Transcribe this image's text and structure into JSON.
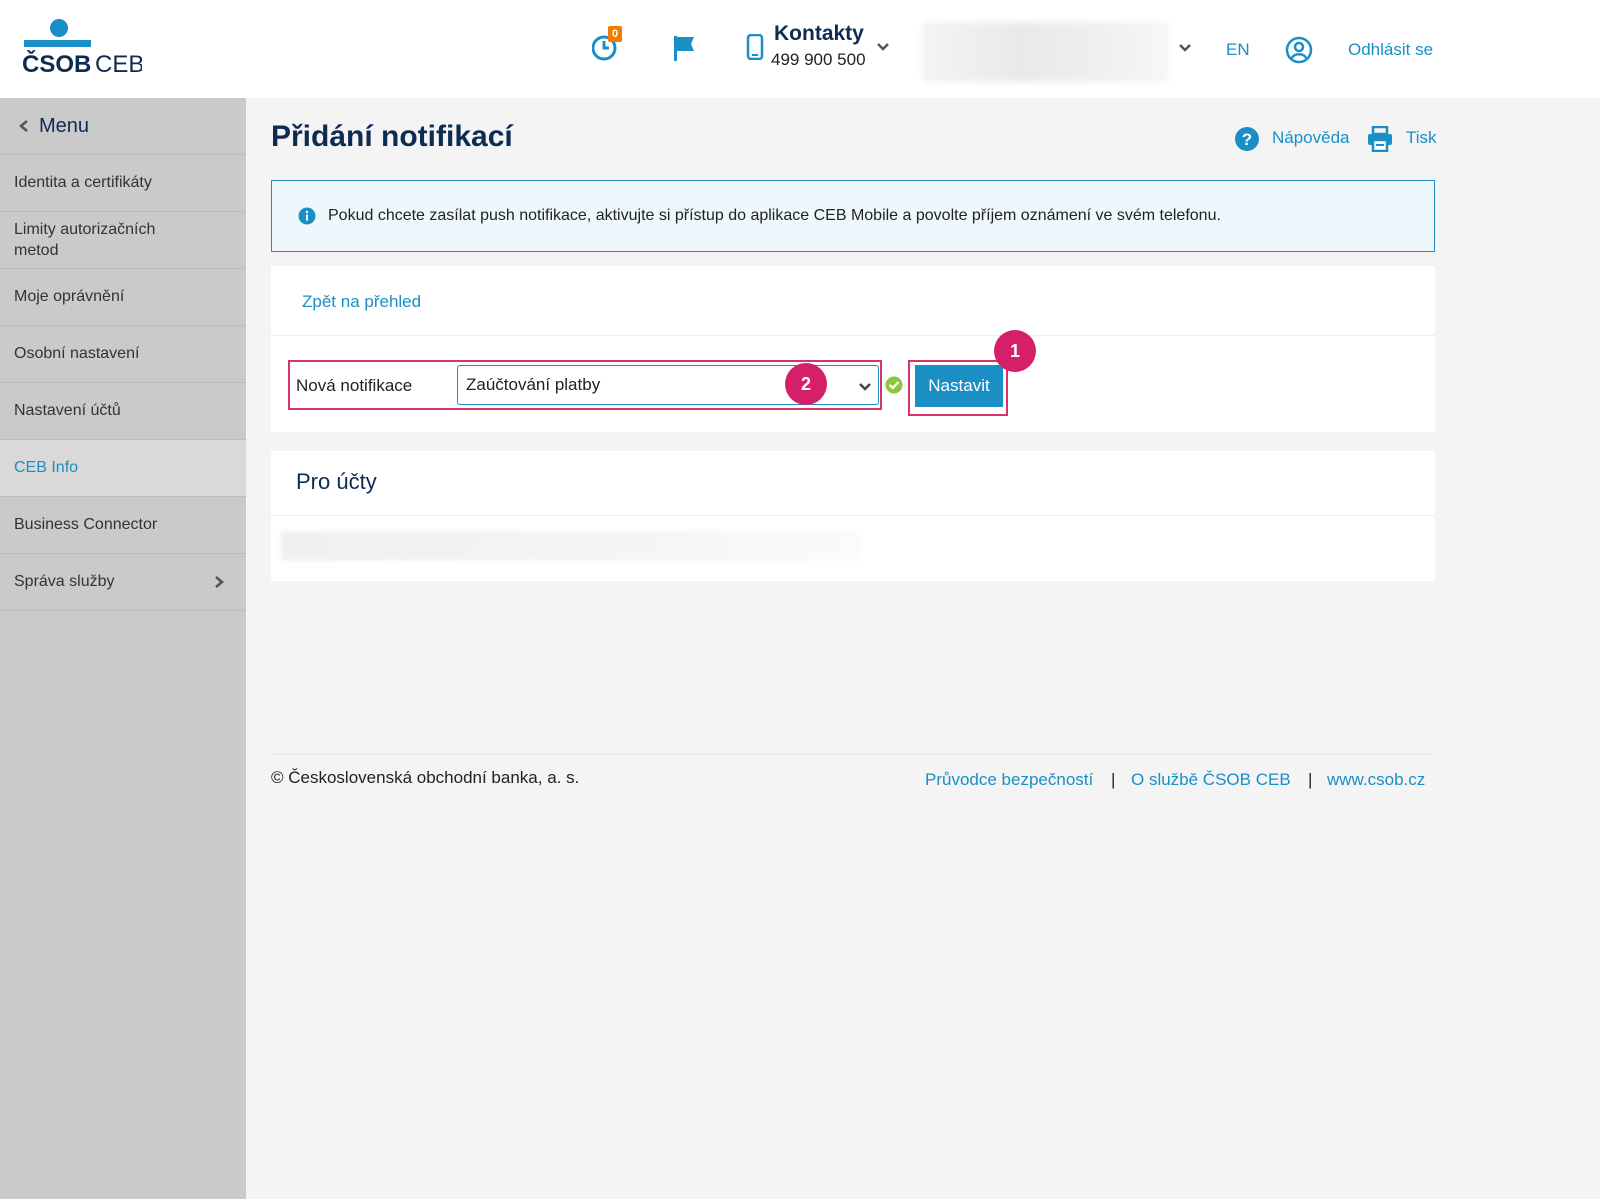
{
  "header": {
    "logo_text": "ČSOB CEB",
    "history_badge": "0",
    "contacts_title": "Kontakty",
    "contacts_phone": "499 900 500",
    "language": "EN",
    "logout": "Odhlásit se"
  },
  "sidebar": {
    "menu_label": "Menu",
    "items": [
      {
        "label": "Identita a certifikáty"
      },
      {
        "label": "Limity autorizačních metod"
      },
      {
        "label": "Moje oprávnění"
      },
      {
        "label": "Osobní nastavení"
      },
      {
        "label": "Nastavení účtů"
      },
      {
        "label": "CEB Info",
        "active": true
      },
      {
        "label": "Business Connector"
      },
      {
        "label": "Správa služby",
        "has_submenu": true
      }
    ]
  },
  "main": {
    "title": "Přidání notifikací",
    "help": "Nápověda",
    "print": "Tisk",
    "info_text": "Pokud chcete zasílat push notifikace, aktivujte si přístup do aplikace CEB Mobile a povolte příjem oznámení ve svém telefonu.",
    "back_link": "Zpět na přehled",
    "new_notification_label": "Nová notifikace",
    "select_value": "Zaúčtování platby",
    "set_button": "Nastavit",
    "markers": [
      "1",
      "2"
    ],
    "accounts_title": "Pro účty"
  },
  "footer": {
    "copyright": "© Československá obchodní banka, a. s.",
    "links": [
      "Průvodce bezpečností",
      "O službě ČSOB CEB",
      "www.csob.cz"
    ],
    "separator": "|"
  },
  "colors": {
    "brand_navy": "#0e2b52",
    "link_blue": "#1a8fc6",
    "marker_pink": "#d61f69",
    "highlight_frame": "#d6336c",
    "ok_green": "#8cc63f"
  }
}
